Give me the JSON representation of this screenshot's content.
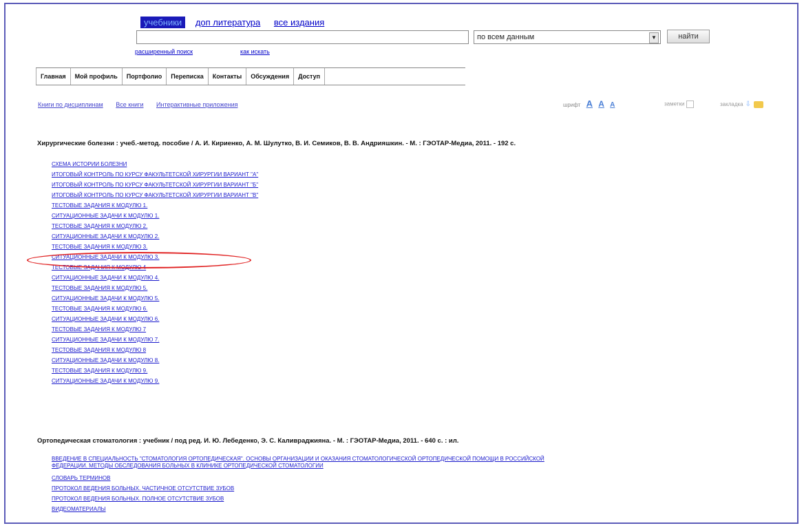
{
  "search": {
    "scopes": [
      "учебники",
      "доп литература",
      "все издания"
    ],
    "active_scope": "учебники",
    "query": "",
    "scope_select": "по всем данным",
    "find_label": "найти",
    "advanced_link": "расширенный поиск",
    "howto_link": "как искать"
  },
  "nav": {
    "tabs": [
      "Главная",
      "Мой профиль",
      "Портфолио",
      "Переписка",
      "Контакты",
      "Обсуждения",
      "Доступ"
    ]
  },
  "subnav": {
    "links": [
      "Книги по дисциплинам",
      "Все книги",
      "Интерактивные приложения"
    ],
    "font_label": "шрифт",
    "font_sizes": [
      "A",
      "A",
      "A"
    ],
    "notes_label": "заметки",
    "bookmark_label": "закладка"
  },
  "books": [
    {
      "title": "Хирургические болезни : учеб.-метод. пособие / А. И. Кириенко, А. М. Шулутко, В. И. Семиков, В. В. Андрияшкин. - М. : ГЭОТАР-Медиа, 2011. - 192 с.",
      "chapters": [
        "СХЕМА ИСТОРИИ БОЛЕЗНИ",
        "ИТОГОВЫЙ КОНТРОЛЬ ПО КУРСУ ФАКУЛЬТЕТСКОЙ ХИРУРГИИ ВАРИАНТ \"А\"",
        "ИТОГОВЫЙ КОНТРОЛЬ ПО КУРСУ ФАКУЛЬТЕТСКОЙ ХИРУРГИИ ВАРИАНТ \"Б\"",
        "ИТОГОВЫЙ КОНТРОЛЬ ПО КУРСУ ФАКУЛЬТЕТСКОЙ ХИРУРГИИ ВАРИАНТ \"В\"",
        "ТЕСТОВЫЕ ЗАДАНИЯ К МОДУЛЮ 1.",
        "СИТУАЦИОННЫЕ ЗАДАЧИ К МОДУЛЮ 1.",
        "ТЕСТОВЫЕ ЗАДАНИЯ К МОДУЛЮ 2.",
        "СИТУАЦИОННЫЕ ЗАДАЧИ К МОДУЛЮ 2.",
        "ТЕСТОВЫЕ ЗАДАНИЯ К МОДУЛЮ 3.",
        "СИТУАЦИОННЫЕ ЗАДАЧИ К МОДУЛЮ 3.",
        "ТЕСТОВЫЕ ЗАДАНИЯ К МОДУЛЮ 4",
        "СИТУАЦИОННЫЕ ЗАДАЧИ К МОДУЛЮ 4.",
        "ТЕСТОВЫЕ ЗАДАНИЯ К МОДУЛЮ 5.",
        "СИТУАЦИОННЫЕ ЗАДАЧИ К МОДУЛЮ 5.",
        "ТЕСТОВЫЕ ЗАДАНИЯ К МОДУЛЮ 6.",
        "СИТУАЦИОННЫЕ ЗАДАЧИ К МОДУЛЮ 6.",
        "ТЕСТОВЫЕ ЗАДАНИЯ К МОДУЛЮ 7",
        "СИТУАЦИОННЫЕ ЗАДАЧИ К МОДУЛЮ 7.",
        "ТЕСТОВЫЕ ЗАДАНИЯ К МОДУЛЮ 8",
        "СИТУАЦИОННЫЕ ЗАДАЧИ К МОДУЛЮ 8.",
        "ТЕСТОВЫЕ ЗАДАНИЯ К МОДУЛЮ 9.",
        "СИТУАЦИОННЫЕ ЗАДАЧИ К МОДУЛЮ 9."
      ],
      "highlighted_index": 8
    },
    {
      "title": "Ортопедическая стоматология : учебник / под ред. И. Ю. Лебеденко, Э. С. Каливраджияна. - М. : ГЭОТАР-Медиа, 2011. - 640 с. : ил.",
      "chapters": [
        "ВВЕДЕНИЕ В СПЕЦИАЛЬНОСТЬ \"СТОМАТОЛОГИЯ ОРТОПЕДИЧЕСКАЯ\". ОСНОВЫ ОРГАНИЗАЦИИ И ОКАЗАНИЯ СТОМАТОЛОГИЧЕСКОЙ ОРТОПЕДИЧЕСКОЙ ПОМОЩИ В РОССИЙСКОЙ ФЕДЕРАЦИИ. МЕТОДЫ ОБСЛЕДОВАНИЯ БОЛЬНЫХ В КЛИНИКЕ ОРТОПЕДИЧЕСКОЙ СТОМАТОЛОГИИ",
        "СЛОВАРЬ ТЕРМИНОВ",
        "ПРОТОКОЛ ВЕДЕНИЯ БОЛЬНЫХ. ЧАСТИЧНОЕ ОТСУТСТВИЕ ЗУБОВ",
        "ПРОТОКОЛ ВЕДЕНИЯ БОЛЬНЫХ. ПОЛНОЕ ОТСУТСТВИЕ ЗУБОВ",
        "ВИДЕОМАТЕРИАЛЫ"
      ]
    }
  ],
  "colors": {
    "frame_border": "#5a5ab8",
    "link": "#1a1acc",
    "active_scope_bg": "#1a1ab8",
    "highlight": "#e02020"
  }
}
